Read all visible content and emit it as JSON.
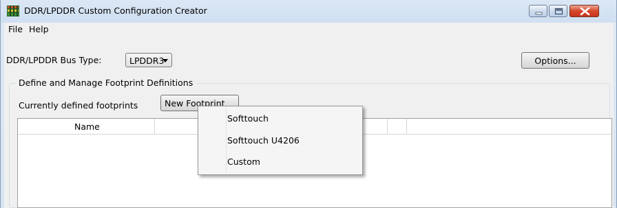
{
  "window": {
    "title": "DDR/LPDDR Custom Configuration Creator",
    "controls": [
      "minimize",
      "maximize",
      "close"
    ]
  },
  "menu": [
    "File",
    "Help"
  ],
  "bus": {
    "label": "DDR/LPDDR Bus Type:",
    "selected": "LPDDR3"
  },
  "options_label": "Options...",
  "group": {
    "title": "Define and Manage Footprint Definitions",
    "footprints_label": "Currently defined footprints",
    "new_footprint_label": "New Footprint"
  },
  "grid": {
    "columns": [
      "Name",
      "",
      "",
      ""
    ]
  },
  "dropdown": {
    "items": [
      "Softtouch",
      "Softtouch U4206",
      "Custom"
    ]
  },
  "colors": {
    "titlebar": "#d6e3f2",
    "close_button": "#d7472c",
    "client": "#f0f0f0"
  }
}
